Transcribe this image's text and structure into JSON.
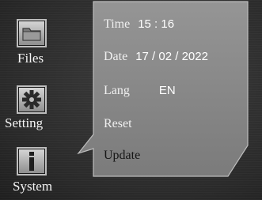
{
  "sidebar": {
    "items": [
      {
        "label": "Files",
        "icon": "folder-icon"
      },
      {
        "label": "Setting",
        "icon": "gear-icon"
      },
      {
        "label": "System",
        "icon": "info-icon"
      }
    ]
  },
  "settings": {
    "time_label": "Time",
    "time_value": "15 : 16",
    "date_label": "Date",
    "date_value": "17 / 02 / 2022",
    "lang_label": "Lang",
    "lang_value": "EN",
    "reset_label": "Reset",
    "update_label": "Update"
  },
  "colors": {
    "panel": "#8a8a8a",
    "panel_edge": "#b5b5b5",
    "background": "#2f2f2f",
    "text": "#f5f5f5"
  }
}
